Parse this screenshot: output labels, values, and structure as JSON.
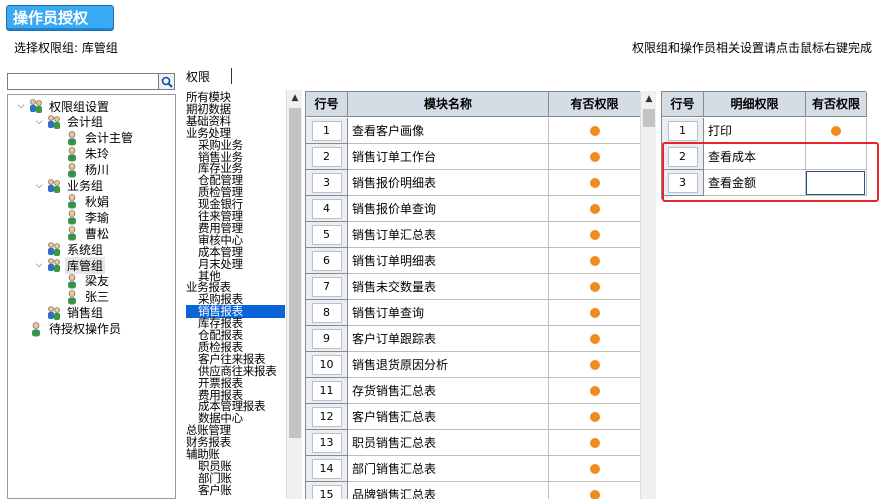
{
  "header": {
    "title": "操作员授权",
    "group_line": "选择权限组: 库管组",
    "hint": "权限组和操作员相关设置请点击鼠标右键完成"
  },
  "search": {
    "value": "",
    "placeholder": ""
  },
  "tree": [
    {
      "label": "权限组设置",
      "level": 0,
      "expander": "expanded",
      "icon": "users-group-icon"
    },
    {
      "label": "会计组",
      "level": 1,
      "expander": "expanded",
      "icon": "users-group-icon"
    },
    {
      "label": "会计主管",
      "level": 2,
      "expander": "none",
      "icon": "user-icon"
    },
    {
      "label": "朱玲",
      "level": 2,
      "expander": "none",
      "icon": "user-icon"
    },
    {
      "label": "杨川",
      "level": 2,
      "expander": "none",
      "icon": "user-icon"
    },
    {
      "label": "业务组",
      "level": 1,
      "expander": "expanded",
      "icon": "users-group-icon"
    },
    {
      "label": "秋娟",
      "level": 2,
      "expander": "none",
      "icon": "user-icon"
    },
    {
      "label": "李瑜",
      "level": 2,
      "expander": "none",
      "icon": "user-icon"
    },
    {
      "label": "曹松",
      "level": 2,
      "expander": "none",
      "icon": "user-icon"
    },
    {
      "label": "系统组",
      "level": 1,
      "expander": "none",
      "icon": "users-group-icon"
    },
    {
      "label": "库管组",
      "level": 1,
      "expander": "expanded",
      "icon": "users-group-icon",
      "selected": true
    },
    {
      "label": "梁友",
      "level": 2,
      "expander": "none",
      "icon": "user-icon"
    },
    {
      "label": "张三",
      "level": 2,
      "expander": "none",
      "icon": "user-icon"
    },
    {
      "label": "销售组",
      "level": 1,
      "expander": "none",
      "icon": "users-group-icon"
    },
    {
      "label": "待授权操作员",
      "level": 0,
      "expander": "none",
      "icon": "user-icon"
    }
  ],
  "rights_tab": "权限",
  "modules": [
    {
      "label": "所有模块",
      "indent": 0
    },
    {
      "label": "期初数据",
      "indent": 0
    },
    {
      "label": "基础资料",
      "indent": 0
    },
    {
      "label": "业务处理",
      "indent": 0
    },
    {
      "label": "采购业务",
      "indent": 1
    },
    {
      "label": "销售业务",
      "indent": 1
    },
    {
      "label": "库存业务",
      "indent": 1
    },
    {
      "label": "仓配管理",
      "indent": 1
    },
    {
      "label": "质检管理",
      "indent": 1
    },
    {
      "label": "现金银行",
      "indent": 1
    },
    {
      "label": "往来管理",
      "indent": 1
    },
    {
      "label": "费用管理",
      "indent": 1
    },
    {
      "label": "审核中心",
      "indent": 1
    },
    {
      "label": "成本管理",
      "indent": 1
    },
    {
      "label": "月末处理",
      "indent": 1
    },
    {
      "label": "其他",
      "indent": 1
    },
    {
      "label": "业务报表",
      "indent": 0
    },
    {
      "label": "采购报表",
      "indent": 1
    },
    {
      "label": "销售报表",
      "indent": 1,
      "selected": true
    },
    {
      "label": "库存报表",
      "indent": 1
    },
    {
      "label": "仓配报表",
      "indent": 1
    },
    {
      "label": "质检报表",
      "indent": 1
    },
    {
      "label": "客户往来报表",
      "indent": 1
    },
    {
      "label": "供应商往来报表",
      "indent": 1
    },
    {
      "label": "开票报表",
      "indent": 1
    },
    {
      "label": "费用报表",
      "indent": 1
    },
    {
      "label": "成本管理报表",
      "indent": 1
    },
    {
      "label": "数据中心",
      "indent": 1
    },
    {
      "label": "总账管理",
      "indent": 0
    },
    {
      "label": "财务报表",
      "indent": 0
    },
    {
      "label": "辅助账",
      "indent": 0
    },
    {
      "label": "职员账",
      "indent": 1
    },
    {
      "label": "部门账",
      "indent": 1
    },
    {
      "label": "客户账",
      "indent": 1
    }
  ],
  "module_grid": {
    "headers": [
      "行号",
      "模块名称",
      "有否权限"
    ],
    "rows": [
      {
        "no": "1",
        "name": "查看客户画像",
        "granted": true
      },
      {
        "no": "2",
        "name": "销售订单工作台",
        "granted": true
      },
      {
        "no": "3",
        "name": "销售报价明细表",
        "granted": true
      },
      {
        "no": "4",
        "name": "销售报价单查询",
        "granted": true
      },
      {
        "no": "5",
        "name": "销售订单汇总表",
        "granted": true
      },
      {
        "no": "6",
        "name": "销售订单明细表",
        "granted": true
      },
      {
        "no": "7",
        "name": "销售未交数量表",
        "granted": true
      },
      {
        "no": "8",
        "name": "销售订单查询",
        "granted": true
      },
      {
        "no": "9",
        "name": "客户订单跟踪表",
        "granted": true
      },
      {
        "no": "10",
        "name": "销售退货原因分析",
        "granted": true
      },
      {
        "no": "11",
        "name": "存货销售汇总表",
        "granted": true
      },
      {
        "no": "12",
        "name": "客户销售汇总表",
        "granted": true
      },
      {
        "no": "13",
        "name": "职员销售汇总表",
        "granted": true
      },
      {
        "no": "14",
        "name": "部门销售汇总表",
        "granted": true
      },
      {
        "no": "15",
        "name": "品牌销售汇总表",
        "granted": true
      }
    ]
  },
  "detail_grid": {
    "headers": [
      "行号",
      "明细权限",
      "有否权限"
    ],
    "rows": [
      {
        "no": "1",
        "name": "打印",
        "granted": true
      },
      {
        "no": "2",
        "name": "查看成本",
        "granted": false
      },
      {
        "no": "3",
        "name": "查看金额",
        "granted": false
      }
    ]
  },
  "colors": {
    "title_bg": "#3aa9f4",
    "grid_header": "#d4dde6",
    "granted_dot": "#f08c1e",
    "selection": "#0a64d8",
    "highlight_box": "#e8232a"
  }
}
